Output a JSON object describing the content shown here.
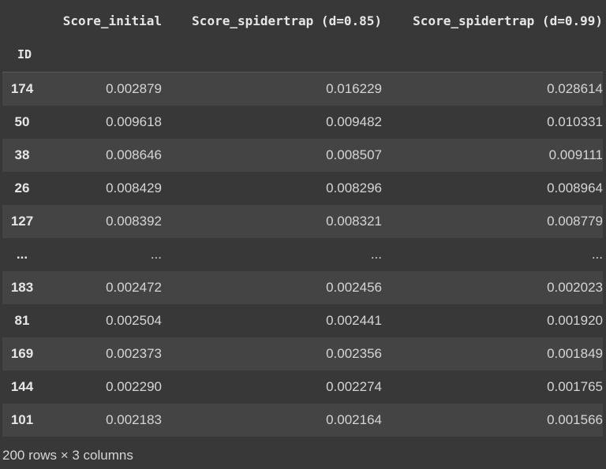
{
  "table": {
    "index_name": "ID",
    "columns": [
      "Score_initial",
      "Score_spidertrap (d=0.85)",
      "Score_spidertrap (d=0.99)"
    ],
    "rows": [
      {
        "id": "174",
        "values": [
          "0.002879",
          "0.016229",
          "0.028614"
        ]
      },
      {
        "id": "50",
        "values": [
          "0.009618",
          "0.009482",
          "0.010331"
        ]
      },
      {
        "id": "38",
        "values": [
          "0.008646",
          "0.008507",
          "0.009111"
        ]
      },
      {
        "id": "26",
        "values": [
          "0.008429",
          "0.008296",
          "0.008964"
        ]
      },
      {
        "id": "127",
        "values": [
          "0.008392",
          "0.008321",
          "0.008779"
        ]
      },
      {
        "id": "...",
        "values": [
          "...",
          "...",
          "..."
        ]
      },
      {
        "id": "183",
        "values": [
          "0.002472",
          "0.002456",
          "0.002023"
        ]
      },
      {
        "id": "81",
        "values": [
          "0.002504",
          "0.002441",
          "0.001920"
        ]
      },
      {
        "id": "169",
        "values": [
          "0.002373",
          "0.002356",
          "0.001849"
        ]
      },
      {
        "id": "144",
        "values": [
          "0.002290",
          "0.002274",
          "0.001765"
        ]
      },
      {
        "id": "101",
        "values": [
          "0.002183",
          "0.002164",
          "0.001566"
        ]
      }
    ]
  },
  "footer": "200 rows × 3 columns"
}
